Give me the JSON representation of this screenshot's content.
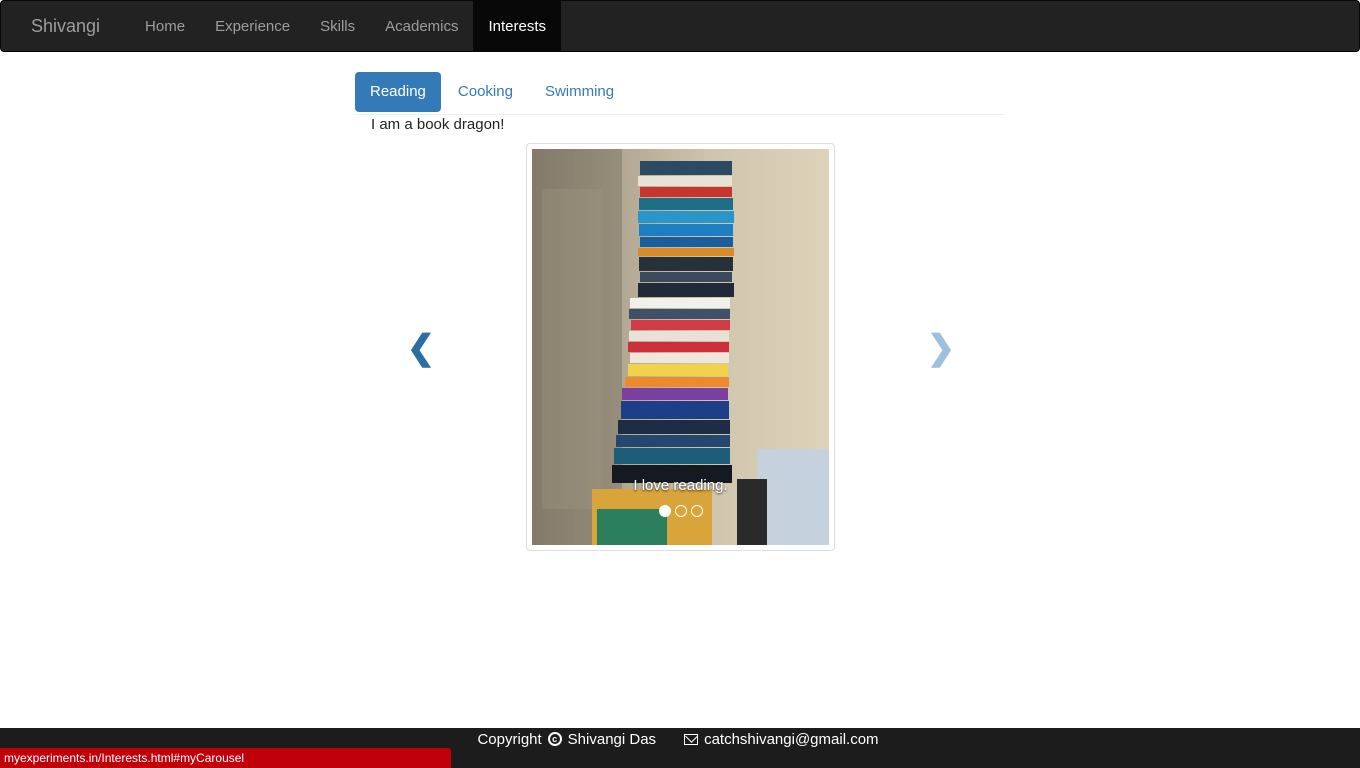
{
  "brand": "Shivangi",
  "nav_items": [
    "Home",
    "Experience",
    "Skills",
    "Academics",
    "Interests"
  ],
  "active_nav": "Interests",
  "tabs": [
    "Reading",
    "Cooking",
    "Swimming"
  ],
  "active_tab": "Reading",
  "tagline": "I am a book dragon!",
  "carousel": {
    "caption": "I love reading.",
    "slides_count": 3,
    "active_index": 0,
    "prev_icon": "chevron-left-icon",
    "next_icon": "chevron-right-icon"
  },
  "footer": {
    "copyright_label": "Copyright",
    "author": "Shivangi Das",
    "email": "catchshivangi@gmail.com"
  },
  "status_url": "myexperiments.in/Interests.html#myCarousel",
  "colors": {
    "navbar": "#222222",
    "primary": "#337ab7",
    "status_bar": "#c0000a"
  }
}
